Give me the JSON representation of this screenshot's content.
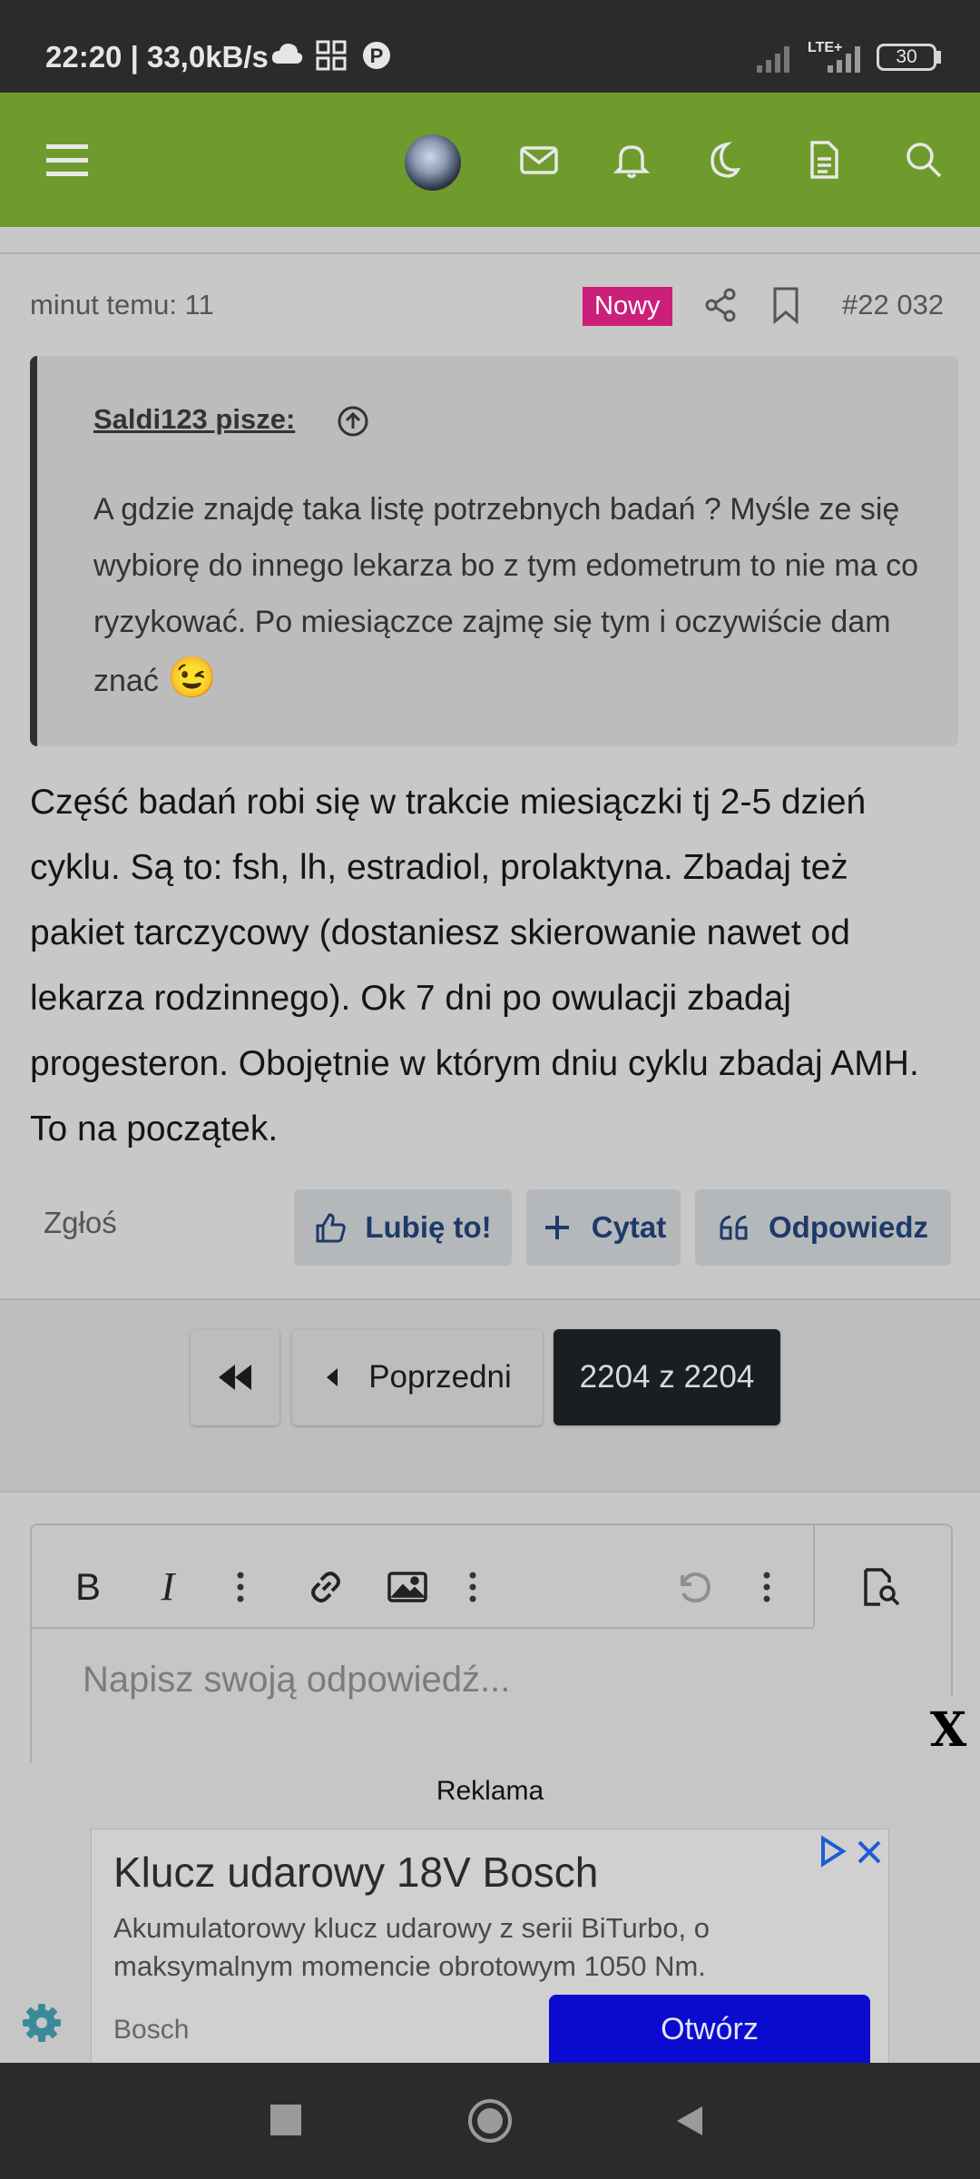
{
  "status_bar": {
    "time_speed": "22:20 | 33,0kB/s",
    "network": "LTE+",
    "battery": "30"
  },
  "header": {
    "icons": [
      "menu-icon",
      "avatar",
      "mail-icon",
      "bell-icon",
      "moon-icon",
      "document-icon",
      "search-icon"
    ],
    "bg_color": "#6f9b2c"
  },
  "post": {
    "time": "minut temu: 11",
    "badge": "Nowy",
    "number": "#22 032",
    "quote": {
      "author": "Saldi123 pisze:",
      "text": "A gdzie znajdę taka listę potrzebnych badań ? Myśle ze się wybiorę do innego lekarza bo z tym edometrum to nie ma co ryzykować. Po miesiączce zajmę się tym i oczywiście dam znać",
      "emoji": "😉"
    },
    "body": "Część badań robi się w trakcie miesiączki tj 2-5 dzień cyklu. Są to: fsh, lh, estradiol, prolaktyna. Zbadaj też pakiet tarczycowy (dostaniesz skierowanie nawet od lekarza rodzinnego). Ok 7 dni po owulacji zbadaj progesteron. Obojętnie w którym dniu cyklu zbadaj AMH. To na początek.",
    "report": "Zgłoś",
    "like": "Lubię to!",
    "quote_btn": "Cytat",
    "reply": "Odpowiedz"
  },
  "pagination": {
    "prev": "Poprzedni",
    "current": "2204 z 2204"
  },
  "editor": {
    "placeholder": "Napisz swoją odpowiedź..."
  },
  "ad": {
    "label": "Reklama",
    "title": "Klucz udarowy 18V Bosch",
    "description": "Akumulatorowy klucz udarowy z serii BiTurbo, o maksymalnym momencie obrotowym 1050 Nm.",
    "advertiser": "Bosch",
    "cta": "Otwórz",
    "close": "X"
  }
}
